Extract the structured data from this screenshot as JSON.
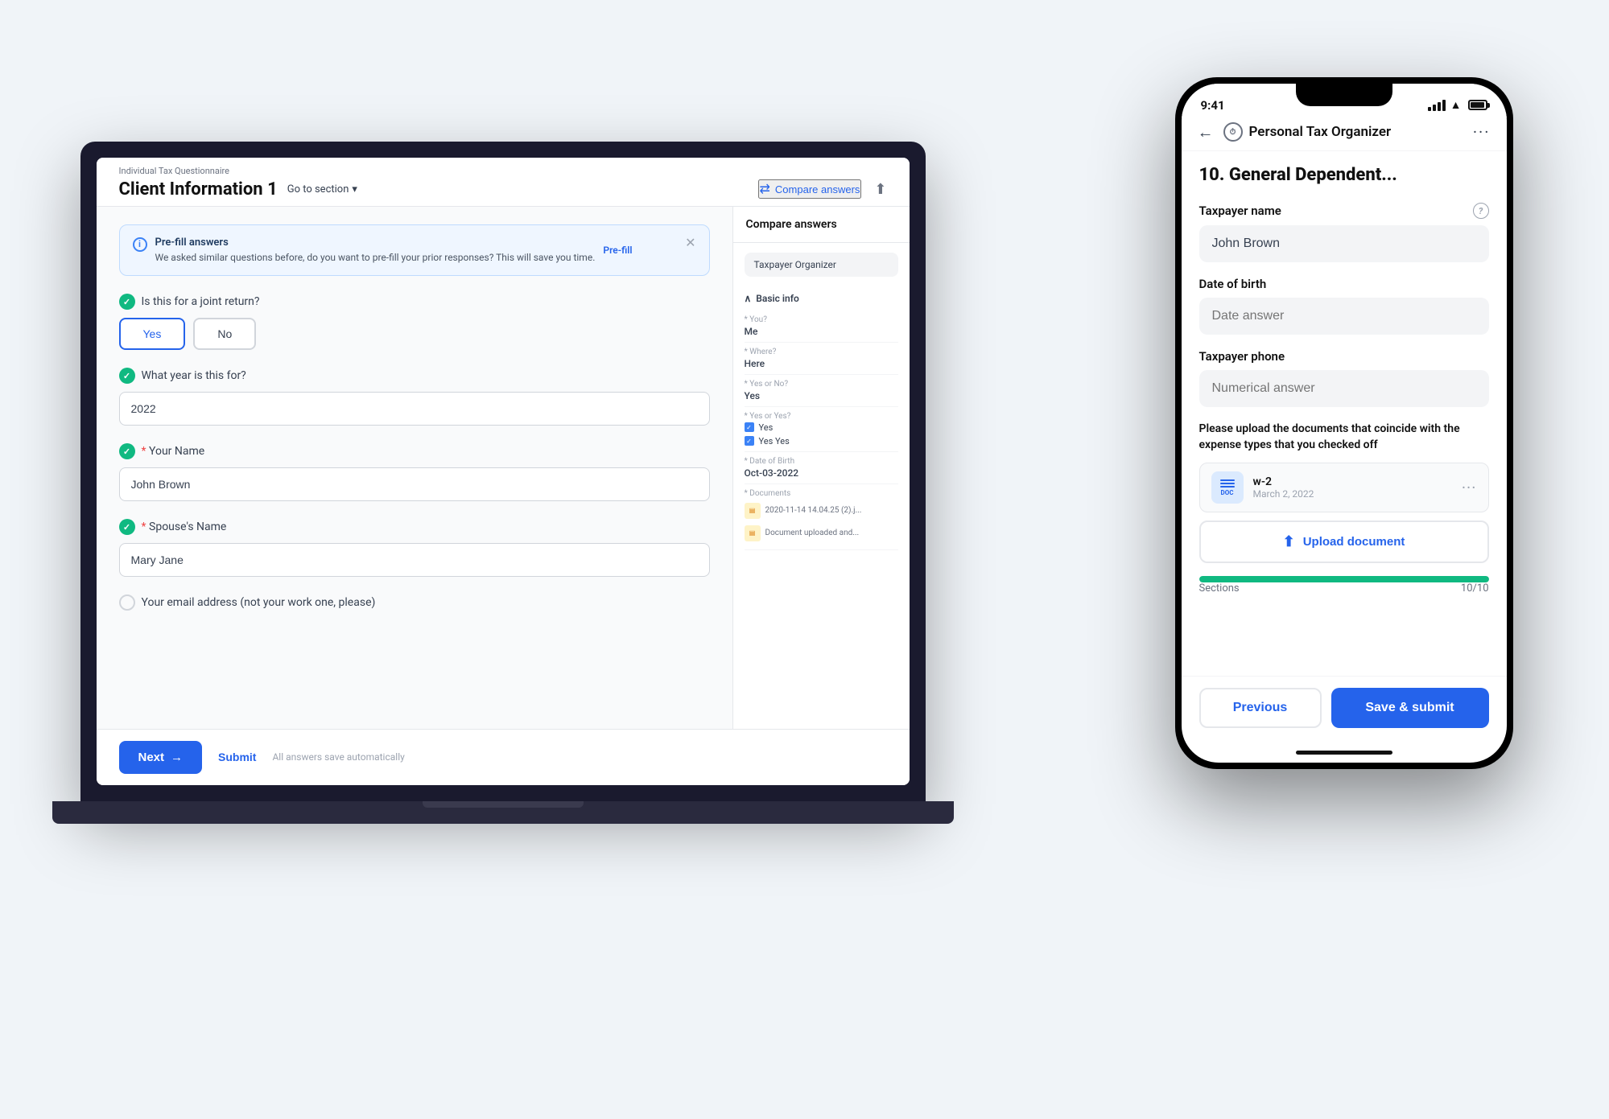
{
  "laptop": {
    "breadcrumb": "Individual Tax Questionnaire",
    "title": "Client Information 1",
    "goto_section": "Go to section",
    "compare_answers": "Compare answers",
    "prefill": {
      "title": "Pre-fill answers",
      "description": "We asked similar questions before, do you want to pre-fill your prior responses? This will save you time.",
      "link": "Pre-fill"
    },
    "questions": [
      {
        "label": "Is this for a joint return?",
        "type": "toggle",
        "options": [
          "Yes",
          "No"
        ],
        "selected": "Yes"
      },
      {
        "label": "What year is this for?",
        "type": "text",
        "value": "2022",
        "required": false
      },
      {
        "label": "Your Name",
        "type": "text",
        "value": "John Brown",
        "required": true
      },
      {
        "label": "Spouse's Name",
        "type": "text",
        "value": "Mary Jane",
        "required": true
      },
      {
        "label": "Your email address (not your work one, please)",
        "type": "text",
        "value": "",
        "required": false
      }
    ],
    "footer": {
      "next": "Next",
      "submit": "Submit",
      "autosave": "All answers save automatically"
    },
    "compare_panel": {
      "title": "Compare answers",
      "tab": "Taxpayer Organizer",
      "section": "Basic info",
      "items": [
        {
          "label": "* You?",
          "value": "Me"
        },
        {
          "label": "* Where?",
          "value": "Here"
        },
        {
          "label": "* Yes or No?",
          "value": "Yes"
        },
        {
          "label": "* Yes or Yes?",
          "type": "checkboxes",
          "options": [
            {
              "label": "Yes",
              "checked": true
            },
            {
              "label": "Yes Yes",
              "checked": true
            }
          ]
        },
        {
          "label": "* Date of Birth",
          "value": "Oct-03-2022"
        },
        {
          "label": "* Documents",
          "type": "docs",
          "docs": [
            "2020-11-14 14.04.25 (2).j...",
            "Document uploaded and..."
          ]
        }
      ]
    }
  },
  "phone": {
    "status_time": "9:41",
    "nav_title": "Personal Tax Organizer",
    "question_number": "10.",
    "question_title": "General Dependent...",
    "fields": [
      {
        "label": "Taxpayer name",
        "value": "John Brown",
        "placeholder": "",
        "type": "filled",
        "has_help": true
      },
      {
        "label": "Date of birth",
        "value": "",
        "placeholder": "Date answer",
        "type": "placeholder",
        "has_help": false
      },
      {
        "label": "Taxpayer phone",
        "value": "",
        "placeholder": "Numerical answer",
        "type": "placeholder",
        "has_help": false
      }
    ],
    "upload_section": {
      "label": "Please upload the documents that coincide with the expense types that you checked off",
      "doc": {
        "name": "w-2",
        "date": "March 2, 2022"
      },
      "upload_button": "Upload document"
    },
    "progress": {
      "label": "Sections",
      "value": "10/10",
      "percent": 100
    },
    "footer": {
      "previous": "Previous",
      "save_submit": "Save & submit"
    }
  }
}
